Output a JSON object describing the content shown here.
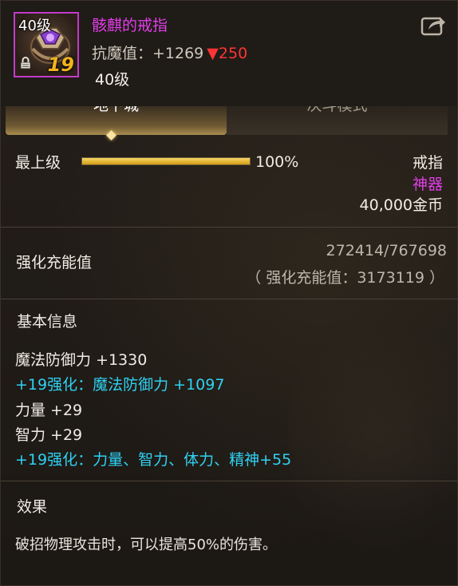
{
  "header": {
    "level_tag": "40级",
    "plus_tag": "19",
    "item_name": "骸麒的戒指",
    "resist_label": "抗魔值：+1269",
    "resist_diff": "▼250",
    "required_level": "40级"
  },
  "tabs": [
    {
      "label": "地下城",
      "active": true
    },
    {
      "label": "决斗模式",
      "active": false
    }
  ],
  "grade": {
    "label": "最上级",
    "percent_text": "100%",
    "percent_value": 1.0
  },
  "item": {
    "type": "戒指",
    "rarity": "神器",
    "price": "40,000金币"
  },
  "charge": {
    "label": "强化充能值",
    "value": "272414/767698",
    "total": "（ 强化充能值：3173119 ）"
  },
  "basic_info": {
    "title": "基本信息",
    "stats": [
      {
        "text": "魔法防御力 +1330",
        "color": "white"
      },
      {
        "text": "+19强化：魔法防御力 +1097",
        "color": "blue"
      },
      {
        "text": "力量 +29",
        "color": "white"
      },
      {
        "text": "智力 +29",
        "color": "white"
      },
      {
        "text": "+19强化：力量、智力、体力、精神+55",
        "color": "blue"
      }
    ]
  },
  "effect": {
    "title": "效果",
    "text": "破招物理攻击时，可以提高50%的伤害。"
  },
  "colors": {
    "epic": "#e23ee8",
    "enhance": "#2fd1f2",
    "decrease": "#ff3434",
    "gold": "#f2b41d"
  }
}
